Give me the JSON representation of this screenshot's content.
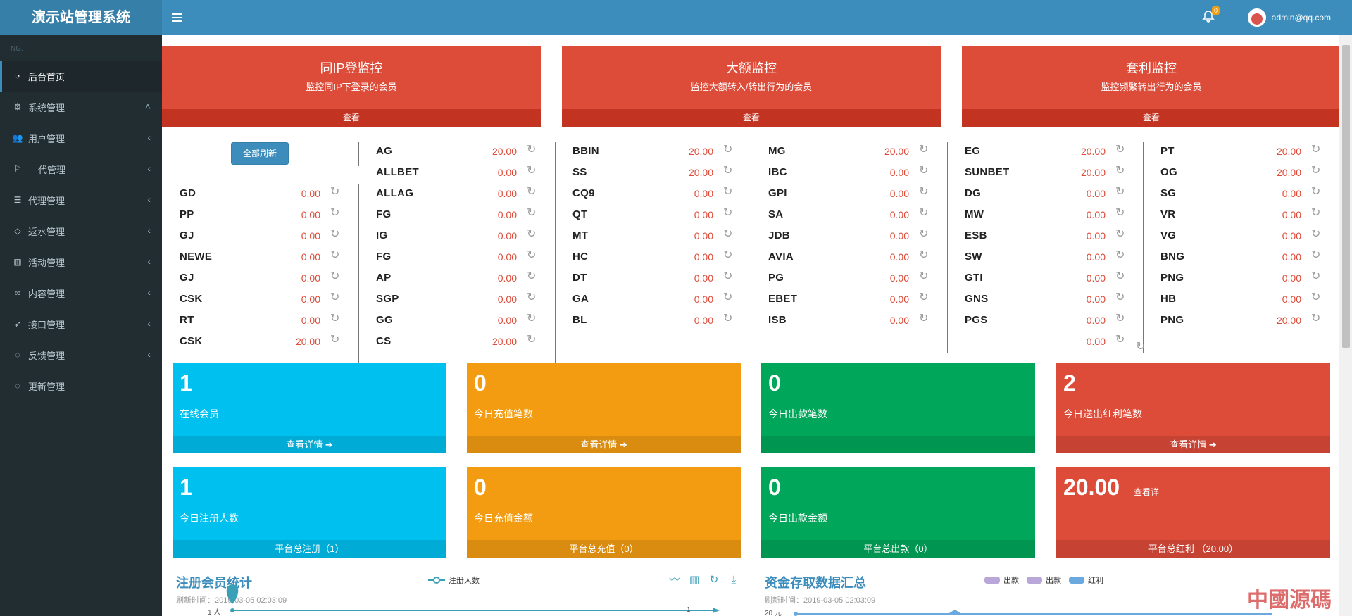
{
  "app": {
    "title": "演示站管理系统"
  },
  "header": {
    "notification_count": "0",
    "user_email": "admin@qq.com"
  },
  "sidebar": {
    "header": "NG.",
    "items": [
      {
        "label": "后台首页",
        "icon": "dashboard-icon"
      },
      {
        "label": "系统管理",
        "icon": "gear-icon"
      },
      {
        "label": "用户管理",
        "icon": "users-icon"
      },
      {
        "label": "代管理",
        "icon": "agent-icon"
      },
      {
        "label": "代理管理",
        "icon": "list-icon"
      },
      {
        "label": "返水管理",
        "icon": "eye-icon"
      },
      {
        "label": "活动管理",
        "icon": "map-icon"
      },
      {
        "label": "内容管理",
        "icon": "link-icon"
      },
      {
        "label": "接口管理",
        "icon": "rocket-icon"
      },
      {
        "label": "反馈管理",
        "icon": "comment-icon"
      },
      {
        "label": "更新管理",
        "icon": "comment-icon"
      }
    ]
  },
  "monitors": [
    {
      "title": "同IP登监控",
      "desc": "监控同IP下登录的会员",
      "link": "查看"
    },
    {
      "title": "大额监控",
      "desc": "监控大额转入/转出行为的会员",
      "link": "查看"
    },
    {
      "title": "套利监控",
      "desc": "监控频繁转出行为的会员",
      "link": "查看"
    }
  ],
  "refresh_all_label": "全部刷新",
  "platform_columns": [
    [
      {
        "name": "GD",
        "value": "0.00"
      },
      {
        "name": "PP",
        "value": "0.00"
      },
      {
        "name": "GJ",
        "value": "0.00"
      },
      {
        "name": "NEWE",
        "value": "0.00"
      },
      {
        "name": "GJ",
        "value": "0.00"
      },
      {
        "name": "CSK",
        "value": "0.00"
      },
      {
        "name": "RT",
        "value": "0.00"
      },
      {
        "name": "CSK",
        "value": "20.00"
      }
    ],
    [
      {
        "name": "AG",
        "value": "20.00"
      },
      {
        "name": "ALLBET",
        "value": "0.00"
      },
      {
        "name": "ALLAG",
        "value": "0.00"
      },
      {
        "name": "FG",
        "value": "0.00"
      },
      {
        "name": "IG",
        "value": "0.00"
      },
      {
        "name": "FG",
        "value": "0.00"
      },
      {
        "name": "AP",
        "value": "0.00"
      },
      {
        "name": "SGP",
        "value": "0.00"
      },
      {
        "name": "GG",
        "value": "0.00"
      },
      {
        "name": "CS",
        "value": "20.00"
      }
    ],
    [
      {
        "name": "BBIN",
        "value": "20.00"
      },
      {
        "name": "SS",
        "value": "20.00"
      },
      {
        "name": "CQ9",
        "value": "0.00"
      },
      {
        "name": "QT",
        "value": "0.00"
      },
      {
        "name": "MT",
        "value": "0.00"
      },
      {
        "name": "HC",
        "value": "0.00"
      },
      {
        "name": "DT",
        "value": "0.00"
      },
      {
        "name": "GA",
        "value": "0.00"
      },
      {
        "name": "BL",
        "value": "0.00"
      }
    ],
    [
      {
        "name": "MG",
        "value": "20.00"
      },
      {
        "name": "IBC",
        "value": "0.00"
      },
      {
        "name": "GPI",
        "value": "0.00"
      },
      {
        "name": "SA",
        "value": "0.00"
      },
      {
        "name": "JDB",
        "value": "0.00"
      },
      {
        "name": "AVIA",
        "value": "0.00"
      },
      {
        "name": "PG",
        "value": "0.00"
      },
      {
        "name": "EBET",
        "value": "0.00"
      },
      {
        "name": "ISB",
        "value": "0.00"
      }
    ],
    [
      {
        "name": "EG",
        "value": "20.00"
      },
      {
        "name": "SUNBET",
        "value": "20.00"
      },
      {
        "name": "DG",
        "value": "0.00"
      },
      {
        "name": "MW",
        "value": "0.00"
      },
      {
        "name": "ESB",
        "value": "0.00"
      },
      {
        "name": "SW",
        "value": "0.00"
      },
      {
        "name": "GTI",
        "value": "0.00"
      },
      {
        "name": "GNS",
        "value": "0.00"
      },
      {
        "name": "PGS",
        "value": "0.00"
      },
      {
        "name": "",
        "value": "0.00"
      }
    ],
    [
      {
        "name": "PT",
        "value": "20.00"
      },
      {
        "name": "OG",
        "value": "20.00"
      },
      {
        "name": "SG",
        "value": "0.00"
      },
      {
        "name": "VR",
        "value": "0.00"
      },
      {
        "name": "VG",
        "value": "0.00"
      },
      {
        "name": "BNG",
        "value": "0.00"
      },
      {
        "name": "PNG",
        "value": "0.00"
      },
      {
        "name": "HB",
        "value": "0.00"
      },
      {
        "name": "PNG",
        "value": "20.00"
      }
    ]
  ],
  "stats_row1": [
    {
      "num": "1",
      "label": "在线会员",
      "footer": "查看详情",
      "color": "#00c0ef"
    },
    {
      "num": "0",
      "label": "今日充值笔数",
      "footer": "查看详情",
      "color": "#f39c12"
    },
    {
      "num": "0",
      "label": "今日出款笔数",
      "footer": "",
      "color": "#00a65a"
    },
    {
      "num": "2",
      "label": "今日送出红利笔数",
      "footer": "查看详情",
      "color": "#dd4b39"
    }
  ],
  "stats_row2": [
    {
      "num": "1",
      "label": "今日注册人数",
      "footer": "平台总注册（1）",
      "color": "#00c0ef"
    },
    {
      "num": "0",
      "label": "今日充值金额",
      "footer": "平台总充值（0）",
      "color": "#f39c12"
    },
    {
      "num": "0",
      "label": "今日出款金额",
      "footer": "平台总出款（0）",
      "color": "#00a65a"
    },
    {
      "num": "20.00",
      "label": "",
      "footer": "平台总红利 （20.00）",
      "color": "#dd4b39"
    }
  ],
  "stat_extra_label": "查看详",
  "charts": [
    {
      "title": "注册会员统计",
      "time": "刷新时间：2019-03-05 02:03:09",
      "legend": [
        "注册人数"
      ],
      "y_tick": "1 人",
      "right_tick": "1",
      "marker_label": "1"
    },
    {
      "title": "资金存取数据汇总",
      "time": "刷新时间：2019-03-05 02:03:09",
      "legend": [
        "出款",
        "出款",
        "红利"
      ],
      "legend_colors": [
        "#b9a7da",
        "#b9a7da",
        "#6aa8e0"
      ],
      "y_tick": "20 元"
    }
  ],
  "chart_data": {
    "type": "line",
    "x": [],
    "series": [
      {
        "name": "注册人数",
        "values": [
          1,
          1
        ]
      }
    ]
  },
  "watermark": "中國源碼"
}
